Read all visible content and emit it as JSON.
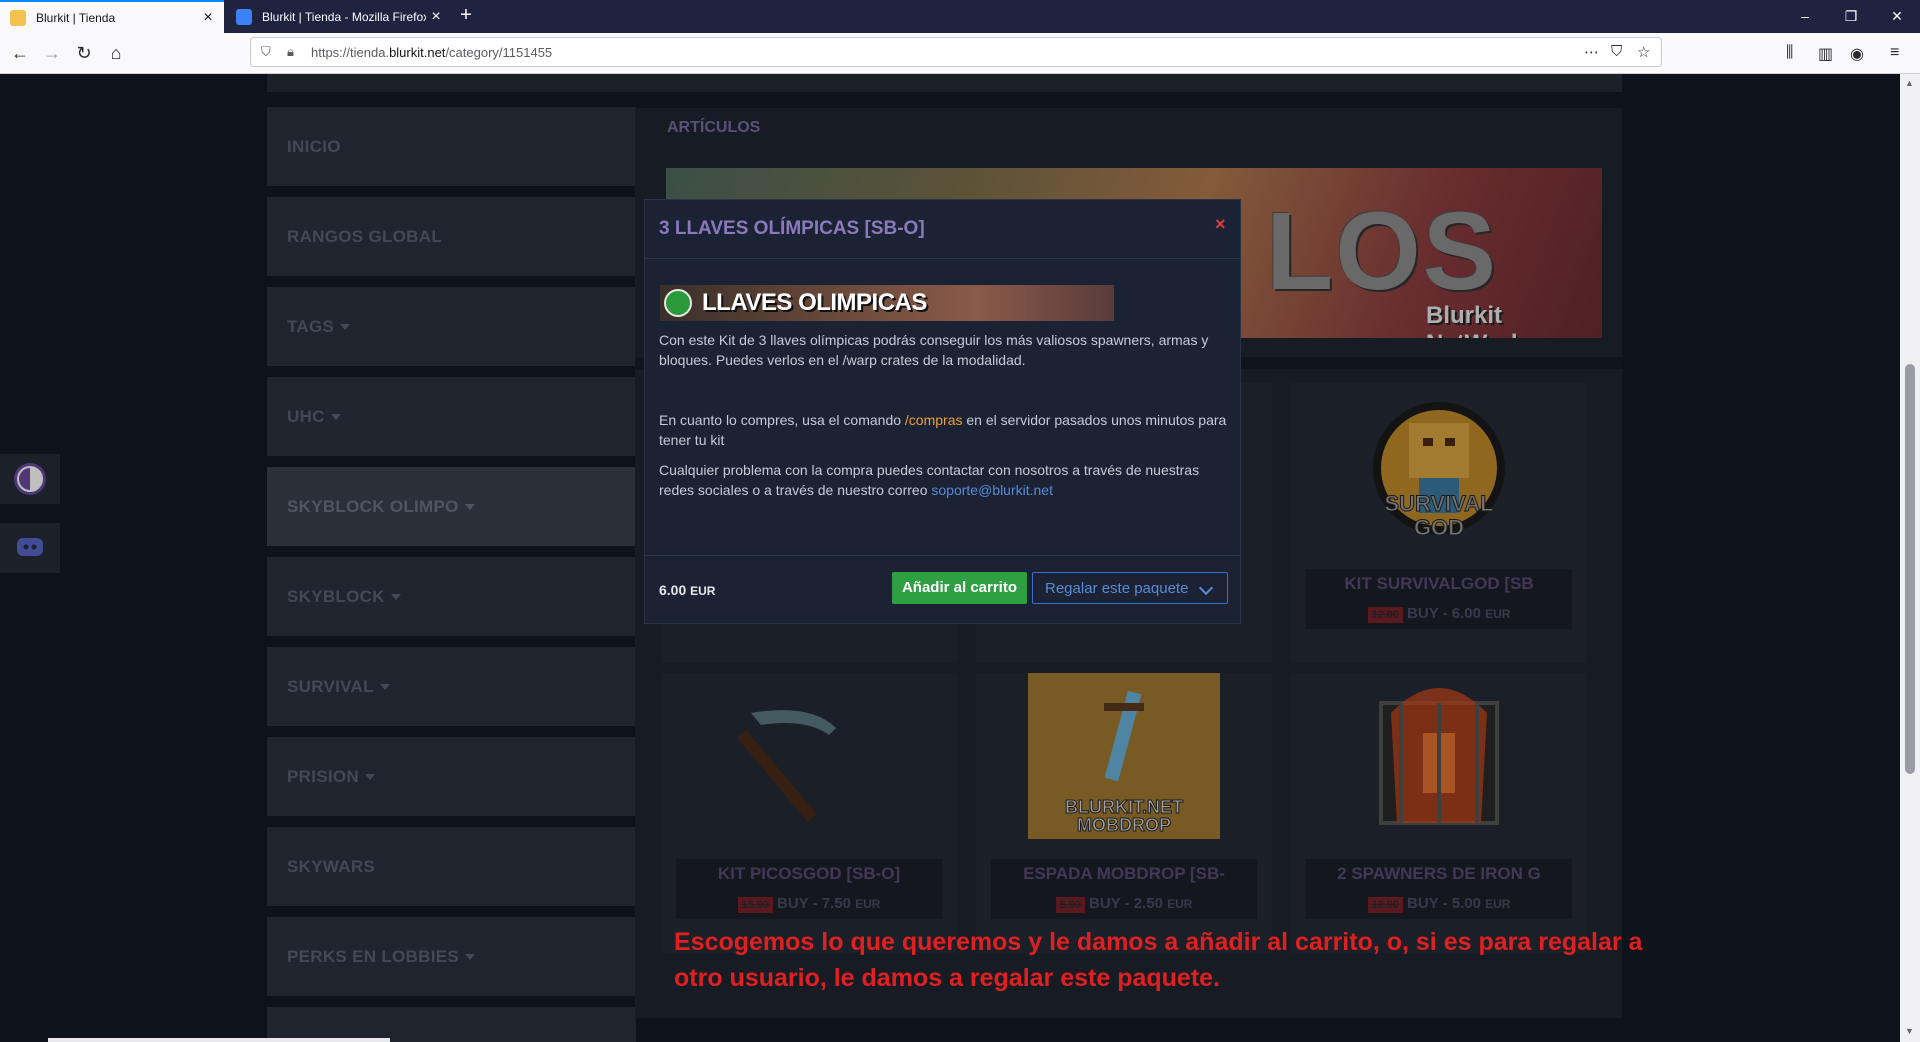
{
  "browser": {
    "tabs": [
      {
        "title": "Blurkit | Tienda",
        "active": true
      },
      {
        "title": "Blurkit | Tienda - Mozilla Firefox",
        "active": false
      }
    ],
    "url": {
      "prefix": "https://tienda.",
      "domain": "blurkit.net",
      "path": "/category/1151455"
    },
    "icons": {
      "back": "back-arrow-icon",
      "forward": "forward-arrow-icon",
      "reload": "reload-icon",
      "home": "home-icon"
    }
  },
  "sidebar": {
    "items": [
      {
        "label": "INICIO",
        "dropdown": false
      },
      {
        "label": "RANGOS GLOBAL",
        "dropdown": false
      },
      {
        "label": "TAGS",
        "dropdown": true
      },
      {
        "label": "UHC",
        "dropdown": true
      },
      {
        "label": "SKYBLOCK OLIMPO",
        "dropdown": true,
        "active": true
      },
      {
        "label": "SKYBLOCK",
        "dropdown": true
      },
      {
        "label": "SURVIVAL",
        "dropdown": true
      },
      {
        "label": "PRISION",
        "dropdown": true
      },
      {
        "label": "SKYWARS",
        "dropdown": false
      },
      {
        "label": "PERKS EN LOBBIES",
        "dropdown": true
      }
    ]
  },
  "main": {
    "title": "ARTÍCULOS",
    "banner": {
      "big_text": "LOS",
      "sub_text": "Blurkit NetWork"
    },
    "cards": [
      {
        "title": "KIT SURVIVALGOD [SB",
        "old_price": "12.00",
        "price_label": "BUY - 6.00",
        "currency": "EUR"
      },
      {
        "title": "KIT PICOSGOD [SB-O]",
        "old_price": "15.00",
        "price_label": "BUY - 7.50",
        "currency": "EUR"
      },
      {
        "title": "ESPADA MOBDROP [SB-",
        "old_price": "5.00",
        "price_label": "BUY - 2.50",
        "currency": "EUR"
      },
      {
        "title": "2 SPAWNERS DE IRON G",
        "old_price": "10.00",
        "price_label": "BUY - 5.00",
        "currency": "EUR"
      }
    ]
  },
  "modal": {
    "title": "3 LLAVES OLÍMPICAS [SB-O]",
    "close": "×",
    "banner_text": "LLAVES OLIMPICAS",
    "p1": "Con este Kit de 3 llaves olímpicas podrás conseguir los más valiosos spawners, armas y bloques. Puedes verlos en el /warp crates de la modalidad.",
    "p2_before": "En cuanto lo compres, usa el comando ",
    "p2_cmd": "/compras",
    "p2_after": " en el servidor pasados unos minutos para tener tu kit",
    "p3_before": "Cualquier problema con la compra puedes contactar con nosotros a través de nuestras redes sociales o a través de nuestro correo ",
    "p3_mail": "soporte@blurkit.net",
    "price": "6.00",
    "currency": "EUR",
    "add_to_cart": "Añadir al carrito",
    "gift": "Regalar este paquete"
  },
  "annotation": {
    "line1": "Escogemos lo que queremos y le damos a añadir al carrito, o, si es para regalar a",
    "line2": "otro usuario, le damos a regalar este paquete."
  },
  "colors": {
    "accent_purple": "#8a79bb",
    "cart_green": "#2ea043",
    "gift_blue": "#5a8ad6",
    "annotation_red": "#e02020"
  }
}
